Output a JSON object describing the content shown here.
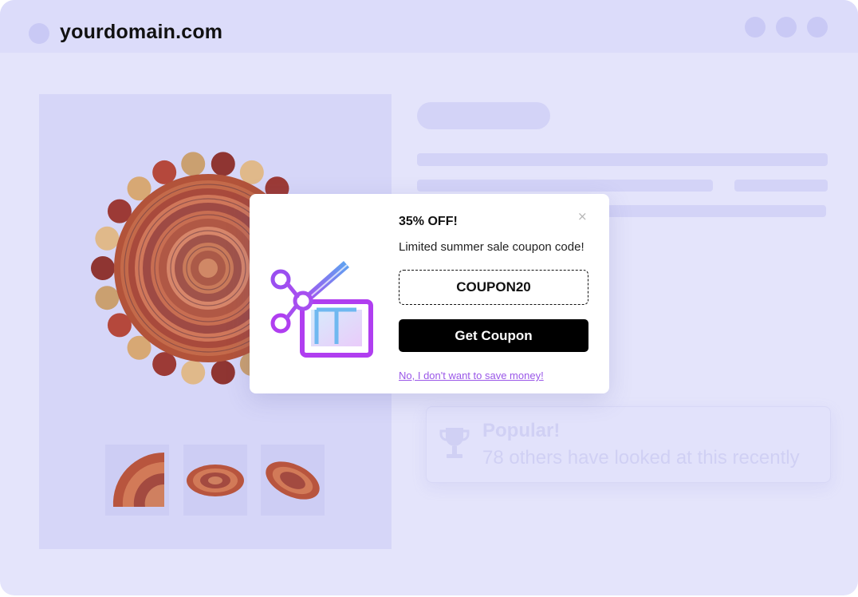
{
  "browser": {
    "domain": "yourdomain.com"
  },
  "product": {
    "popular_title": "Popular!",
    "popular_text": "78 others have looked at this recently",
    "thumbnails": [
      "rug-thumbnail-1",
      "rug-thumbnail-2",
      "rug-thumbnail-3"
    ]
  },
  "popup": {
    "title": "35% OFF!",
    "subtitle": "Limited summer sale coupon code!",
    "coupon_code": "COUPON20",
    "button_label": "Get Coupon",
    "decline_label": "No, I don't want to save money!",
    "close_symbol": "×",
    "icon": "scissors-coupon-icon"
  },
  "colors": {
    "background": "#e4e4fb",
    "accent_purple": "#9a57e8",
    "button": "#000000"
  }
}
